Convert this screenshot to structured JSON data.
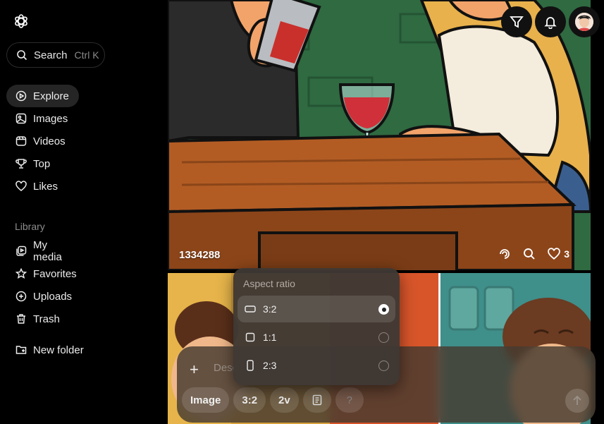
{
  "sidebar": {
    "search": {
      "label": "Search",
      "shortcut": "Ctrl K"
    },
    "nav": [
      {
        "label": "Explore",
        "icon": "play-circle-icon",
        "active": true
      },
      {
        "label": "Images",
        "icon": "image-icon"
      },
      {
        "label": "Videos",
        "icon": "video-icon"
      },
      {
        "label": "Top",
        "icon": "trophy-icon"
      },
      {
        "label": "Likes",
        "icon": "heart-icon"
      }
    ],
    "library_label": "Library",
    "library": [
      {
        "label": "My media",
        "icon": "media-icon"
      },
      {
        "label": "Favorites",
        "icon": "star-icon"
      },
      {
        "label": "Uploads",
        "icon": "upload-icon"
      },
      {
        "label": "Trash",
        "icon": "trash-icon"
      }
    ],
    "new_folder": {
      "label": "New folder",
      "icon": "folder-plus-icon"
    }
  },
  "feed": {
    "tile_top": {
      "id": "1334288",
      "likes": "3"
    }
  },
  "header": {
    "buttons": [
      "filter-icon",
      "bell-icon",
      "avatar"
    ]
  },
  "aspect_menu": {
    "title": "Aspect ratio",
    "options": [
      {
        "label": "3:2",
        "selected": true
      },
      {
        "label": "1:1",
        "selected": false
      },
      {
        "label": "2:3",
        "selected": false
      }
    ]
  },
  "composer": {
    "placeholder": "Desc",
    "chips": {
      "mode": "Image",
      "ratio": "3:2",
      "variants": "2v",
      "help": "?"
    }
  },
  "colors": {
    "sidebar_bg": "#000000",
    "active_bg": "#252525",
    "composer_bg": "#463a30"
  }
}
